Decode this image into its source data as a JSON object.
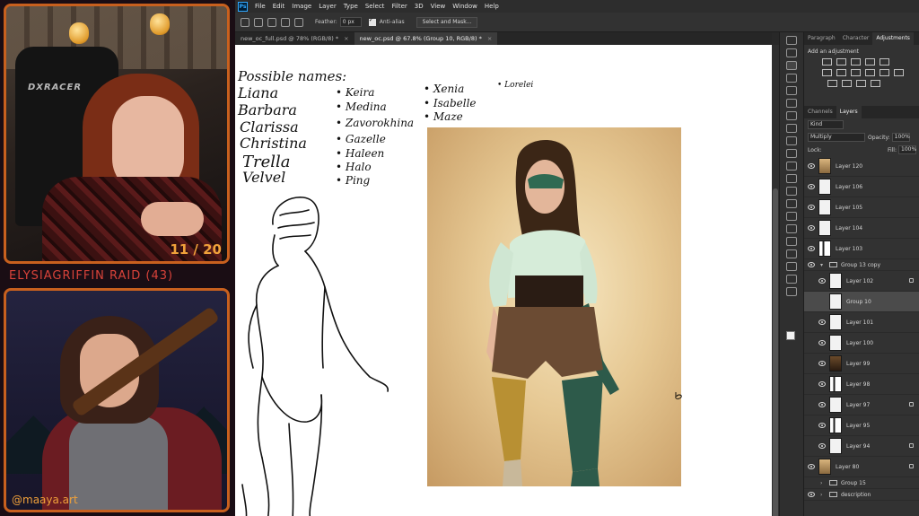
{
  "overlay": {
    "chair_logo": "DXRACER",
    "counter": "11 / 20",
    "raid_text": "ELYSIAGRIFFIN  RAID (43)",
    "art_credit": "@maaya.art",
    "colors": {
      "frame": "#c8601e",
      "counter": "#f0a13a",
      "raid": "#d9433a"
    }
  },
  "menubar": {
    "app_icon": "Ps",
    "items": [
      "File",
      "Edit",
      "Image",
      "Layer",
      "Type",
      "Select",
      "Filter",
      "3D",
      "View",
      "Window",
      "Help"
    ]
  },
  "options": {
    "feather_label": "Feather:",
    "feather_value": "0 px",
    "antialias_label": "Anti-alias",
    "select_mask_label": "Select and Mask..."
  },
  "tabs": [
    {
      "label": "new_oc_full.psd @ 78% (RGB/8) *",
      "close": "×"
    },
    {
      "label": "new_oc.psd @ 67.8% (Group 10, RGB/8) *",
      "close": "×"
    }
  ],
  "canvas": {
    "title": "Possible names:",
    "col1": [
      "Liana",
      "Barbara",
      "Clarissa",
      "Christina",
      "Trella",
      "Velvel"
    ],
    "col2": [
      "• Keira",
      "• Medina",
      "• Zavorokhina",
      "• Gazelle",
      "• Haleen",
      "• Halo",
      "• Ping"
    ],
    "col3": [
      "• Xenia",
      "• Isabelle",
      "• Maze"
    ],
    "col4": [
      "• Lorelei"
    ]
  },
  "panels": {
    "top_tabs": [
      "Paragraph",
      "Character",
      "Adjustments"
    ],
    "add_adjustment": "Add an adjustment",
    "layer_tabs": [
      "Channels",
      "Layers"
    ],
    "kind": "Kind",
    "blend_mode": "Multiply",
    "opacity_label": "Opacity:",
    "opacity_value": "100%",
    "lock_label": "Lock:",
    "fill_label": "Fill:",
    "fill_value": "100%"
  },
  "layers": [
    {
      "name": "Layer 120",
      "thumb": "tan"
    },
    {
      "name": "Layer 106",
      "thumb": "plain"
    },
    {
      "name": "Layer 105",
      "thumb": "plain"
    },
    {
      "name": "Layer 104",
      "thumb": "plain"
    },
    {
      "name": "Layer 103",
      "thumb": "fig"
    },
    {
      "name": "Group 13 copy",
      "thumb": "folder"
    },
    {
      "name": "Layer 102",
      "thumb": "plain"
    },
    {
      "name": "Group 10",
      "thumb": "plain"
    },
    {
      "name": "Layer 101",
      "thumb": "plain"
    },
    {
      "name": "Layer 100",
      "thumb": "plain"
    },
    {
      "name": "Layer 99",
      "thumb": "dark"
    },
    {
      "name": "Layer 98",
      "thumb": "fig"
    },
    {
      "name": "Layer 97",
      "thumb": "plain"
    },
    {
      "name": "Layer 95",
      "thumb": "fig"
    },
    {
      "name": "Layer 94",
      "thumb": "plain"
    },
    {
      "name": "Layer 80",
      "thumb": "tan"
    },
    {
      "name": "Group 15",
      "thumb": "folder"
    },
    {
      "name": "description",
      "thumb": "folder"
    }
  ]
}
